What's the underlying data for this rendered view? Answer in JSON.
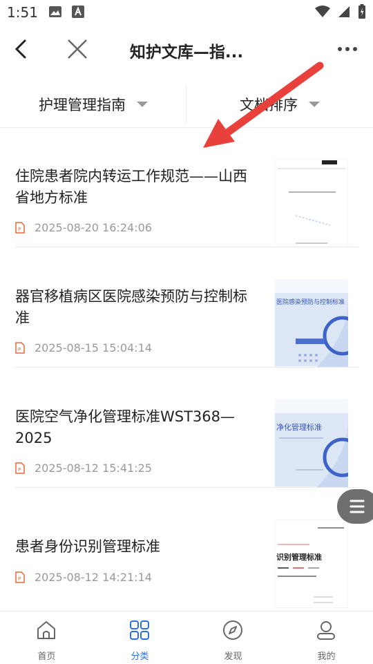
{
  "status": {
    "time": "1:51"
  },
  "nav": {
    "title": "知护文库—指..."
  },
  "filters": [
    {
      "label": "护理管理指南"
    },
    {
      "label": "文档排序"
    }
  ],
  "documents": [
    {
      "title": "住院患者院内转运工作规范——山西省地方标准",
      "date": "2025-08-20 16:24:06"
    },
    {
      "title": "器官移植病区医院感染预防与控制标准",
      "date": "2025-08-15 15:04:14"
    },
    {
      "title": "医院空气净化管理标准WST368—2025",
      "date": "2025-08-12 15:41:25"
    },
    {
      "title": "患者身份识别管理标准",
      "date": "2025-08-12 14:21:14"
    }
  ],
  "thumbs": {
    "t2": "医院感染预防与控制标准",
    "t3": "净化管理标准",
    "t4": "识别管理标准"
  },
  "tabs": [
    {
      "label": "首页",
      "icon": "home-icon"
    },
    {
      "label": "分类",
      "icon": "grid-icon"
    },
    {
      "label": "发现",
      "icon": "compass-icon"
    },
    {
      "label": "我的",
      "icon": "user-icon"
    }
  ],
  "colors": {
    "accent": "#2b6de8",
    "annotation": "#e8403a",
    "pdf": "#e8683a"
  }
}
